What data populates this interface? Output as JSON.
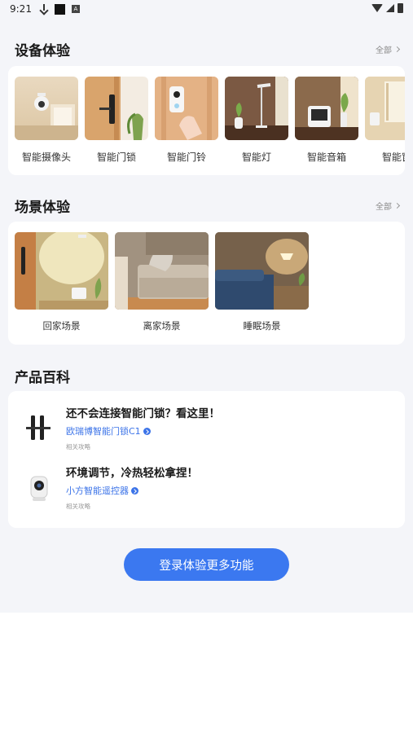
{
  "status_bar": {
    "time": "9:21",
    "a_badge": "A"
  },
  "devices": {
    "title": "设备体验",
    "more": "全部",
    "items": [
      {
        "label": "智能摄像头",
        "icon": "camera-thumb"
      },
      {
        "label": "智能门锁",
        "icon": "door-lock-thumb"
      },
      {
        "label": "智能门铃",
        "icon": "doorbell-thumb"
      },
      {
        "label": "智能灯",
        "icon": "lamp-thumb"
      },
      {
        "label": "智能音箱",
        "icon": "speaker-thumb"
      },
      {
        "label": "智能窗",
        "icon": "window-thumb"
      }
    ]
  },
  "scenes": {
    "title": "场景体验",
    "more": "全部",
    "items": [
      {
        "label": "回家场景"
      },
      {
        "label": "离家场景"
      },
      {
        "label": "睡眠场景"
      }
    ]
  },
  "encyclopedia": {
    "title": "产品百科",
    "articles": [
      {
        "title": "还不会连接智能门锁？看这里！",
        "link": "欧瑞博智能门锁C1",
        "meta": "相关攻略",
        "icon": "door-lock-icon"
      },
      {
        "title": "环境调节，冷热轻松拿捏！",
        "link": "小方智能遥控器",
        "meta": "相关攻略",
        "icon": "remote-camera-icon"
      }
    ]
  },
  "login_button": "登录体验更多功能",
  "colors": {
    "accent": "#3b78f0",
    "link": "#3b73e8",
    "background": "#f4f5f9"
  }
}
